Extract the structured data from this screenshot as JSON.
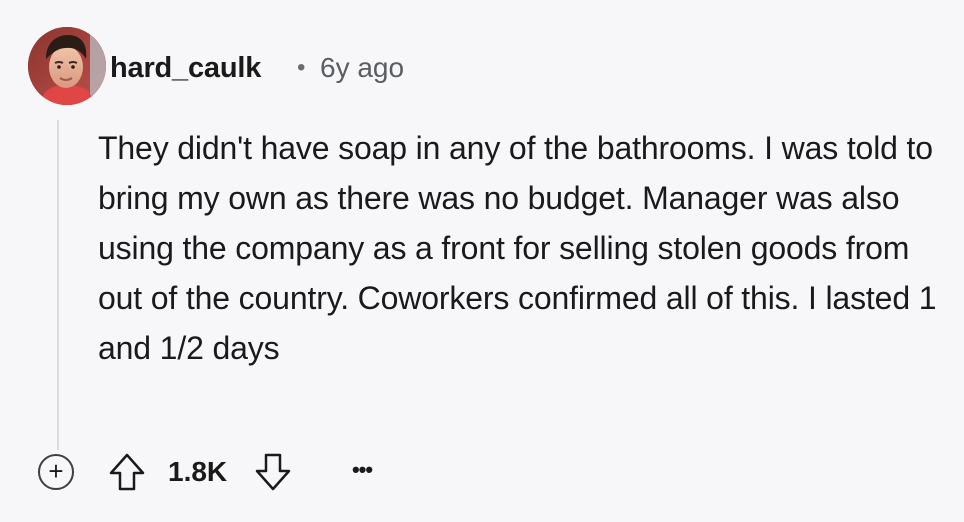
{
  "comment": {
    "author": "hard_caulk",
    "separator": "•",
    "time_ago": "6y ago",
    "avatar_icon": "user-avatar-photo",
    "body": "They didn't have soap in any of the bathrooms. I was told to bring my own as there was no budget. Manager was also using the company as a front for selling stolen goods from out of the country. Coworkers confirmed all of this. I lasted 1 and 1/2 days"
  },
  "actions": {
    "expand_label": "+",
    "expand_icon": "plus-circle-icon",
    "upvote_icon": "upvote-arrow-icon",
    "score": "1.8K",
    "downvote_icon": "downvote-arrow-icon",
    "more_label": "•••",
    "more_icon": "ellipsis-icon"
  },
  "colors": {
    "background": "#f7f7f9",
    "text": "#1a1a1b",
    "muted_text": "#5a5d61",
    "thread_line": "#d9dde1"
  }
}
